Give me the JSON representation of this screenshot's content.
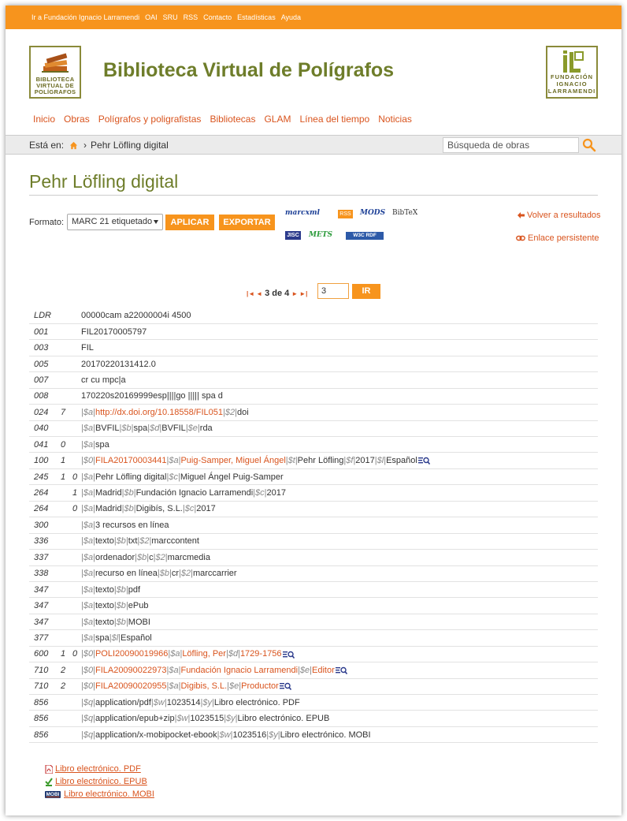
{
  "topbar": {
    "links": [
      "Ir a Fundación Ignacio Larramendi",
      "OAI",
      "SRU",
      "RSS",
      "Contacto",
      "Estadísticas",
      "Ayuda"
    ]
  },
  "header": {
    "site_title": "Biblioteca Virtual de Polígrafos",
    "logo_left_lines": [
      "BIBLIOTECA",
      "VIRTUAL DE",
      "POLÍGRAFOS"
    ],
    "logo_right_lines": [
      "FUNDACIÓN",
      "IGNACIO",
      "LARRAMENDI"
    ]
  },
  "nav": [
    "Inicio",
    "Obras",
    "Polígrafos y poligrafistas",
    "Bibliotecas",
    "GLAM",
    "Línea del tiempo",
    "Noticias"
  ],
  "breadcrumb": {
    "prefix": "Está en:",
    "separator": "›",
    "current": "Pehr Löfling digital"
  },
  "search": {
    "placeholder": "Búsqueda de obras"
  },
  "page_title": "Pehr Löfling digital",
  "format": {
    "label": "Formato:",
    "selected": "MARC 21 etiquetado",
    "apply": "APLICAR",
    "export": "EXPORTAR",
    "icons": {
      "marcxml": "marcxml",
      "rss": "RSS",
      "mods": "MODS",
      "bibtex": "BibTeX",
      "jisc": "JISC",
      "mets": "METS",
      "w3c_rdf": "W3C RDF"
    }
  },
  "side_links": {
    "back": "Volver a resultados",
    "permalink": "Enlace persistente"
  },
  "pager": {
    "text": "3 de 4",
    "input_value": "3",
    "go": "IR"
  },
  "marc_records": [
    {
      "tag": "LDR",
      "ind1": "",
      "ind2": "",
      "value": [
        {
          "t": "00000cam a22000004i 4500"
        }
      ]
    },
    {
      "tag": "001",
      "ind1": "",
      "ind2": "",
      "value": [
        {
          "t": "FIL20170005797"
        }
      ]
    },
    {
      "tag": "003",
      "ind1": "",
      "ind2": "",
      "value": [
        {
          "t": "FIL"
        }
      ]
    },
    {
      "tag": "005",
      "ind1": "",
      "ind2": "",
      "value": [
        {
          "t": "20170220131412.0"
        }
      ]
    },
    {
      "tag": "007",
      "ind1": "",
      "ind2": "",
      "value": [
        {
          "t": "cr cu mpc|a"
        }
      ]
    },
    {
      "tag": "008",
      "ind1": "",
      "ind2": "",
      "value": [
        {
          "t": "170220s20169999esp||||go ||||| spa d"
        }
      ]
    },
    {
      "tag": "024",
      "ind1": "7",
      "ind2": "",
      "value": [
        {
          "c": "$a",
          "t": "http://dx.doi.org/10.18558/FIL051",
          "link": true
        },
        {
          "c": "$2",
          "t": "doi"
        }
      ]
    },
    {
      "tag": "040",
      "ind1": "",
      "ind2": "",
      "value": [
        {
          "c": "$a",
          "t": "BVFIL"
        },
        {
          "c": "$b",
          "t": "spa"
        },
        {
          "c": "$d",
          "t": "BVFIL"
        },
        {
          "c": "$e",
          "t": "rda"
        }
      ]
    },
    {
      "tag": "041",
      "ind1": "0",
      "ind2": "",
      "value": [
        {
          "c": "$a",
          "t": "spa"
        }
      ]
    },
    {
      "tag": "100",
      "ind1": "1",
      "ind2": "",
      "lupa": true,
      "value": [
        {
          "c": "$0",
          "t": "FILA20170003441",
          "link": true
        },
        {
          "c": "$a",
          "t": "Puig-Samper, Miguel Ángel",
          "link": true
        },
        {
          "c": "$t",
          "t": "Pehr Löfling"
        },
        {
          "c": "$f",
          "t": "2017"
        },
        {
          "c": "$l",
          "t": "Español"
        }
      ]
    },
    {
      "tag": "245",
      "ind1": "1",
      "ind2": "0",
      "value": [
        {
          "c": "$a",
          "t": "Pehr Löfling digital"
        },
        {
          "c": "$c",
          "t": "Miguel Ángel Puig-Samper"
        }
      ]
    },
    {
      "tag": "264",
      "ind1": "",
      "ind2": "1",
      "value": [
        {
          "c": "$a",
          "t": "Madrid"
        },
        {
          "c": "$b",
          "t": "Fundación Ignacio Larramendi"
        },
        {
          "c": "$c",
          "t": "2017"
        }
      ]
    },
    {
      "tag": "264",
      "ind1": "",
      "ind2": "0",
      "value": [
        {
          "c": "$a",
          "t": "Madrid"
        },
        {
          "c": "$b",
          "t": "Digibís, S.L."
        },
        {
          "c": "$c",
          "t": "2017"
        }
      ]
    },
    {
      "tag": "300",
      "ind1": "",
      "ind2": "",
      "value": [
        {
          "c": "$a",
          "t": "3 recursos en línea"
        }
      ]
    },
    {
      "tag": "336",
      "ind1": "",
      "ind2": "",
      "value": [
        {
          "c": "$a",
          "t": "texto"
        },
        {
          "c": "$b",
          "t": "txt"
        },
        {
          "c": "$2",
          "t": "marccontent"
        }
      ]
    },
    {
      "tag": "337",
      "ind1": "",
      "ind2": "",
      "value": [
        {
          "c": "$a",
          "t": "ordenador"
        },
        {
          "c": "$b",
          "t": "c"
        },
        {
          "c": "$2",
          "t": "marcmedia"
        }
      ]
    },
    {
      "tag": "338",
      "ind1": "",
      "ind2": "",
      "value": [
        {
          "c": "$a",
          "t": "recurso en línea"
        },
        {
          "c": "$b",
          "t": "cr"
        },
        {
          "c": "$2",
          "t": "marccarrier"
        }
      ]
    },
    {
      "tag": "347",
      "ind1": "",
      "ind2": "",
      "value": [
        {
          "c": "$a",
          "t": "texto"
        },
        {
          "c": "$b",
          "t": "pdf"
        }
      ]
    },
    {
      "tag": "347",
      "ind1": "",
      "ind2": "",
      "value": [
        {
          "c": "$a",
          "t": "texto"
        },
        {
          "c": "$b",
          "t": "ePub"
        }
      ]
    },
    {
      "tag": "347",
      "ind1": "",
      "ind2": "",
      "value": [
        {
          "c": "$a",
          "t": "texto"
        },
        {
          "c": "$b",
          "t": "MOBI"
        }
      ]
    },
    {
      "tag": "377",
      "ind1": "",
      "ind2": "",
      "value": [
        {
          "c": "$a",
          "t": "spa"
        },
        {
          "c": "$l",
          "t": "Español"
        }
      ]
    },
    {
      "tag": "600",
      "ind1": "1",
      "ind2": "0",
      "lupa": true,
      "value": [
        {
          "c": "$0",
          "t": "POLI20090019966",
          "link": true
        },
        {
          "c": "$a",
          "t": "Löfling, Per",
          "link": true
        },
        {
          "c": "$d",
          "t": "1729-1756",
          "link": true
        }
      ]
    },
    {
      "tag": "710",
      "ind1": "2",
      "ind2": "",
      "lupa": true,
      "value": [
        {
          "c": "$0",
          "t": "FILA20090022973",
          "link": true
        },
        {
          "c": "$a",
          "t": "Fundación Ignacio Larramendi",
          "link": true
        },
        {
          "c": "$e",
          "t": "Editor",
          "link": true
        }
      ]
    },
    {
      "tag": "710",
      "ind1": "2",
      "ind2": "",
      "lupa": true,
      "value": [
        {
          "c": "$0",
          "t": "FILA20090020955",
          "link": true
        },
        {
          "c": "$a",
          "t": "Digibis, S.L.",
          "link": true
        },
        {
          "c": "$e",
          "t": "Productor",
          "link": true
        }
      ]
    },
    {
      "tag": "856",
      "ind1": "",
      "ind2": "",
      "value": [
        {
          "c": "$q",
          "t": "application/pdf"
        },
        {
          "c": "$w",
          "t": "1023514"
        },
        {
          "c": "$y",
          "t": "Libro electrónico. PDF"
        }
      ]
    },
    {
      "tag": "856",
      "ind1": "",
      "ind2": "",
      "value": [
        {
          "c": "$q",
          "t": "application/epub+zip"
        },
        {
          "c": "$w",
          "t": "1023515"
        },
        {
          "c": "$y",
          "t": "Libro electrónico. EPUB"
        }
      ]
    },
    {
      "tag": "856",
      "ind1": "",
      "ind2": "",
      "value": [
        {
          "c": "$q",
          "t": "application/x-mobipocket-ebook"
        },
        {
          "c": "$w",
          "t": "1023516"
        },
        {
          "c": "$y",
          "t": "Libro electrónico. MOBI"
        }
      ]
    }
  ],
  "files": [
    {
      "label": "Libro electrónico. PDF",
      "icon": "pdf-icon"
    },
    {
      "label": "Libro electrónico. EPUB",
      "icon": "epub-icon"
    },
    {
      "label": "Libro electrónico. MOBI",
      "icon": "mobi-icon",
      "badge": "MOBI"
    }
  ],
  "colors": {
    "accent": "#f7941d",
    "link": "#d9541e",
    "brand_green": "#6e7d2a"
  }
}
